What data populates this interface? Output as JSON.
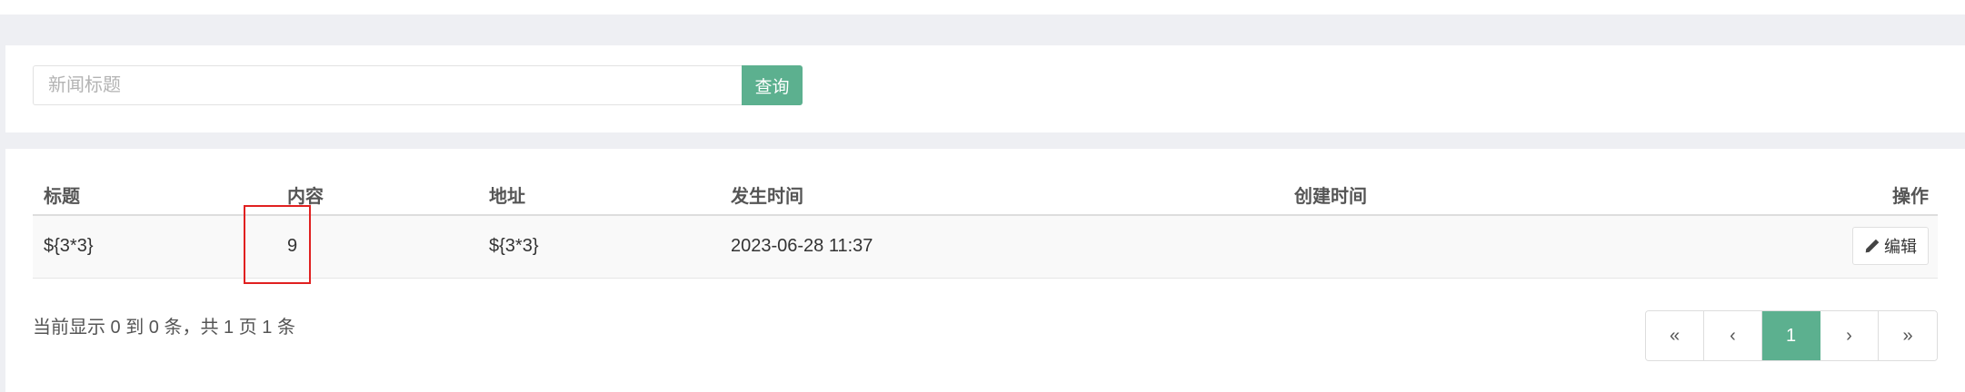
{
  "search": {
    "placeholder": "新闻标题",
    "button_label": "查询"
  },
  "table": {
    "headers": [
      "标题",
      "内容",
      "地址",
      "发生时间",
      "创建时间",
      "操作"
    ],
    "rows": [
      {
        "title": "${3*3}",
        "content": "9",
        "address": "${3*3}",
        "occurred_at": "2023-06-28 11:37",
        "created_at": "",
        "edit_label": "编辑"
      }
    ]
  },
  "footer": {
    "summary": "当前显示 0 到 0 条，共 1 页 1 条",
    "pagination": {
      "first": "«",
      "prev": "‹",
      "current": "1",
      "next": "›",
      "last": "»"
    }
  },
  "colors": {
    "accent": "#5cb08f",
    "highlight": "#e02020"
  },
  "icons": {
    "edit": "pencil-icon"
  }
}
